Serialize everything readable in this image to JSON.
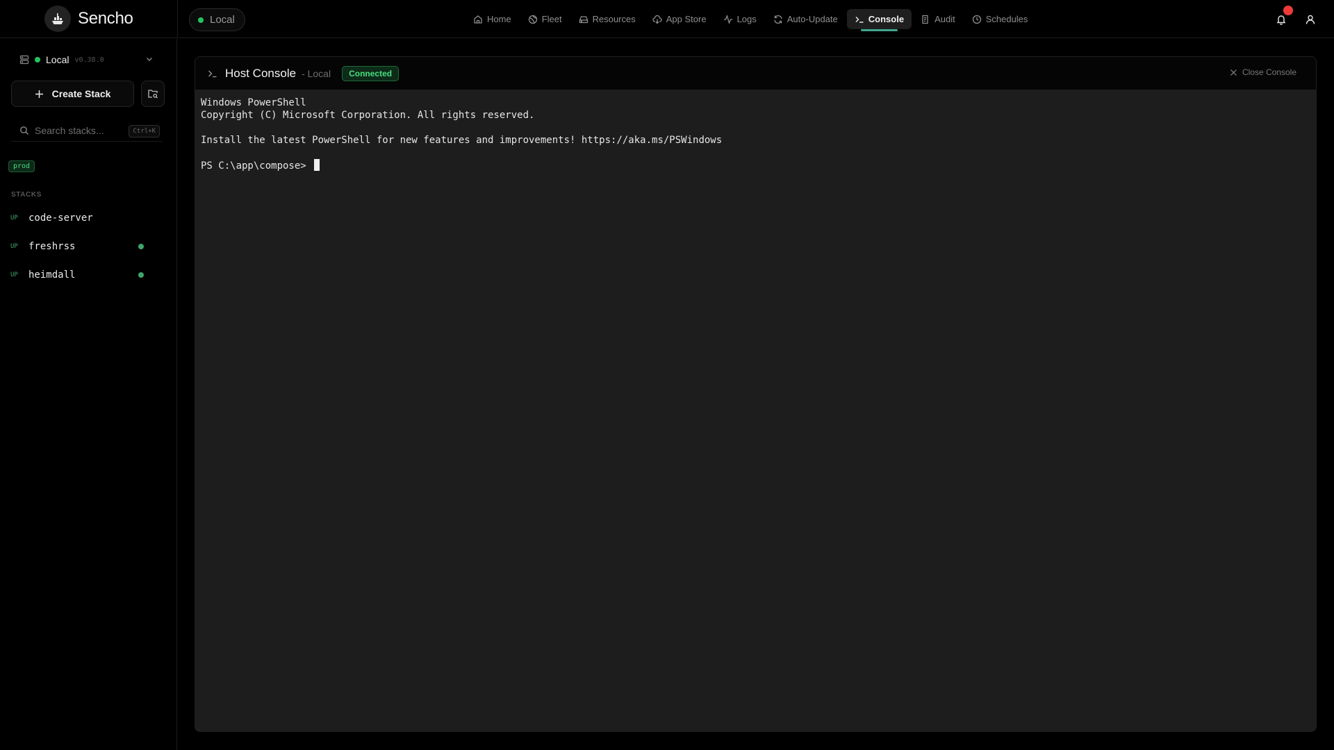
{
  "app": {
    "name": "Sencho",
    "environment": "Local"
  },
  "nav": {
    "items": [
      {
        "label": "Home",
        "icon": "home-icon"
      },
      {
        "label": "Fleet",
        "icon": "fleet-icon"
      },
      {
        "label": "Resources",
        "icon": "resources-icon"
      },
      {
        "label": "App Store",
        "icon": "app-store-icon"
      },
      {
        "label": "Logs",
        "icon": "logs-icon"
      },
      {
        "label": "Auto-Update",
        "icon": "auto-update-icon"
      },
      {
        "label": "Console",
        "icon": "console-icon",
        "active": true
      },
      {
        "label": "Audit",
        "icon": "audit-icon"
      },
      {
        "label": "Schedules",
        "icon": "schedules-icon"
      }
    ]
  },
  "sidebar": {
    "node": {
      "name": "Local",
      "version": "v0.38.0"
    },
    "create_stack_label": "Create Stack",
    "search": {
      "placeholder": "Search stacks...",
      "shortcut": "Ctrl+K"
    },
    "tag": "prod",
    "section_label": "STACKS",
    "stacks": [
      {
        "status": "UP",
        "name": "code-server",
        "indicator": false
      },
      {
        "status": "UP",
        "name": "freshrss",
        "indicator": true
      },
      {
        "status": "UP",
        "name": "heimdall",
        "indicator": true
      }
    ]
  },
  "console": {
    "title": "Host Console",
    "subtitle": "- Local",
    "status": "Connected",
    "close_label": "Close Console",
    "lines": [
      "Windows PowerShell",
      "Copyright (C) Microsoft Corporation. All rights reserved.",
      "",
      "Install the latest PowerShell for new features and improvements! https://aka.ms/PSWindows",
      ""
    ],
    "prompt": "PS C:\\app\\compose> "
  },
  "colors": {
    "accent": "#3fa792",
    "success": "#22c55e",
    "notification": "#ef3a3a"
  }
}
